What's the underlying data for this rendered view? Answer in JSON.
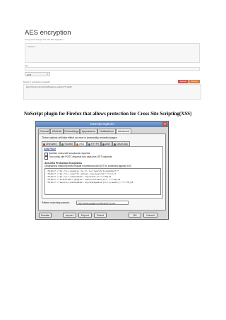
{
  "aes_app": {
    "title": "AES encryption",
    "subtitle": "Encrypt and decrypt text with AES algorithm",
    "text_placeholder": "Plaintext",
    "key_label": "Key",
    "mode_value": "ECB",
    "result_label": "Result of encryption in base64",
    "encrypt_label": "Encrypt",
    "decrypt_label": "Decrypt",
    "result_value": "Eqwl7hKAdn2+6rtCubhpNl5UpjE14L+x4jE6zo7TL1s8R="
  },
  "caption": "NoScript plugin for Firefox that allows protection for Cross Site Scripting(XSS)",
  "dialog": {
    "title": "NoScript Options",
    "close_glyph": "✕",
    "tabs": [
      "General",
      "Whitelist",
      "Embeddings",
      "Appearance",
      "Notifications",
      "Advanced"
    ],
    "note": "These options will take effect on new or (manually) reloaded pages",
    "subtabs": [
      "Untrusted",
      "Trusted",
      "XSS",
      "HTTPS",
      "ABE",
      "ClearClick"
    ],
    "xss_heading": "XSS Filter",
    "checkbox_1": "Sanitize cross-site suspicious requests",
    "checkbox_2": "Turn cross-site POST requests into data-less GET requests",
    "anti_xss_title": "Anti-XSS Protection Exceptions",
    "anti_xss_desc": "Destinations matching these regular expressions will NOT be protected against XSS",
    "exceptions": [
      "^https?://[a-z]+\\.google\\.[a-z\\.]+/(search|ie|webhp)?\\?",
      "^https?://[a-z]+\\.search\\.yahoo\\.com/search(?:\\?|/)\\?",
      "^https?://[a-z]+\\.wikipedia\\.org/wiki/[^\"<>\\?%]+$",
      "^https?://translate\\.google\\.com/translate_t[^\"'<>\\?%]+$",
      "^https?://secure\\.wikimedia\\.org/wikipedia/[a-z]+/wiki/[^\"<>\\?%]+$"
    ],
    "pattern_label": "Pattern matching sample:",
    "pattern_value": "http://www.google.com/search?q=xss",
    "buttons": [
      "Donate",
      "Import",
      "Export",
      "Reset",
      "OK",
      "Cancel"
    ]
  }
}
